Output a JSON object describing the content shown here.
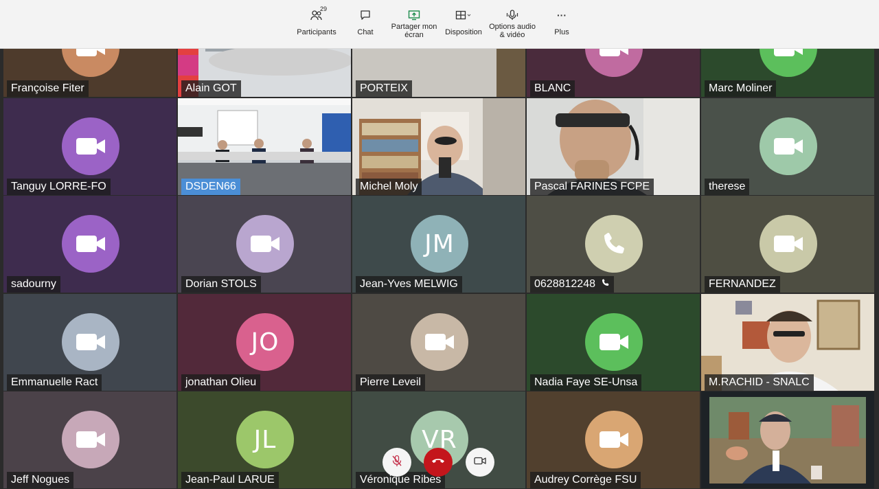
{
  "toolbar": {
    "participants": {
      "label": "Participants",
      "count": "29",
      "icon": "participants-icon"
    },
    "chat": {
      "label": "Chat",
      "icon": "chat-icon"
    },
    "share": {
      "label_line1": "Partager mon",
      "label_line2": "écran",
      "icon": "share-screen-icon"
    },
    "layout": {
      "label": "Disposition",
      "icon": "layout-icon"
    },
    "av": {
      "label_line1": "Options audio",
      "label_line2": "& vidéo",
      "icon": "av-options-icon"
    },
    "more": {
      "label": "Plus",
      "glyph": "···",
      "icon": "more-icon"
    }
  },
  "participants": [
    {
      "name": "Françoise Fiter",
      "type": "camera",
      "color": "#c98a62",
      "bg": "#4e3b2c"
    },
    {
      "name": "Alain GOT",
      "type": "video",
      "scene": "office"
    },
    {
      "name": "PORTEIX",
      "type": "video",
      "scene": "man-suit"
    },
    {
      "name": "BLANC",
      "type": "camera",
      "color": "#c06ba0",
      "bg": "#4a2b3c"
    },
    {
      "name": "Marc Moliner",
      "type": "camera",
      "color": "#5cbf5c",
      "bg": "#2c4a2c"
    },
    {
      "name": "Tanguy LORRE-FO",
      "type": "camera",
      "color": "#9b63c6",
      "bg": "#3e2c4e"
    },
    {
      "name": "DSDEN66",
      "type": "video",
      "scene": "conference",
      "active": true
    },
    {
      "name": "Michel Moly",
      "type": "video",
      "scene": "library"
    },
    {
      "name": "Pascal FARINES FCPE",
      "type": "video",
      "scene": "headset"
    },
    {
      "name": "therese",
      "type": "camera",
      "color": "#9ec9a9",
      "bg": "#4a514a"
    },
    {
      "name": "sadourny",
      "type": "camera",
      "color": "#9b63c6",
      "bg": "#3e2c4e"
    },
    {
      "name": "Dorian STOLS",
      "type": "camera",
      "color": "#b9a6cf",
      "bg": "#4a4551"
    },
    {
      "name": "Jean-Yves MELWIG",
      "type": "initials",
      "initials": "JM",
      "color": "#8fb2b7",
      "bg": "#3e4a4b"
    },
    {
      "name": "0628812248",
      "type": "phone",
      "color": "#cfcfb0",
      "bg": "#4e4e45",
      "phone_glyph": "📞"
    },
    {
      "name": "FERNANDEZ",
      "type": "camera",
      "color": "#c9c9a8",
      "bg": "#4e4e42"
    },
    {
      "name": "Emmanuelle Ract",
      "type": "camera",
      "color": "#a9b5c4",
      "bg": "#40464e"
    },
    {
      "name": "jonathan Olieu",
      "type": "initials",
      "initials": "JO",
      "color": "#d9618e",
      "bg": "#52293a"
    },
    {
      "name": "Pierre Leveil",
      "type": "camera",
      "color": "#c8b8a6",
      "bg": "#4e4a44"
    },
    {
      "name": "Nadia  Faye SE-Unsa",
      "type": "camera",
      "color": "#5cbf5c",
      "bg": "#2c4a2c"
    },
    {
      "name": "M.RACHID - SNALC",
      "type": "video",
      "scene": "home"
    },
    {
      "name": "Jeff Nogues",
      "type": "camera",
      "color": "#c7a8b8",
      "bg": "#4b4249"
    },
    {
      "name": "Jean-Paul LARUE",
      "type": "initials",
      "initials": "JL",
      "color": "#9cc76a",
      "bg": "#3c4a2c"
    },
    {
      "name": "Véronique Ribes",
      "type": "initials",
      "initials": "VR",
      "color": "#a7c9ad",
      "bg": "#414c44"
    },
    {
      "name": "Audrey Corrège FSU",
      "type": "camera",
      "color": "#d9a673",
      "bg": "#51402e"
    },
    {
      "name": "",
      "type": "video",
      "scene": "tapestry"
    }
  ],
  "controls": {
    "mute": {
      "icon": "mic-off-icon"
    },
    "hangup": {
      "icon": "hang-up-icon"
    },
    "video": {
      "icon": "video-camera-icon"
    }
  }
}
